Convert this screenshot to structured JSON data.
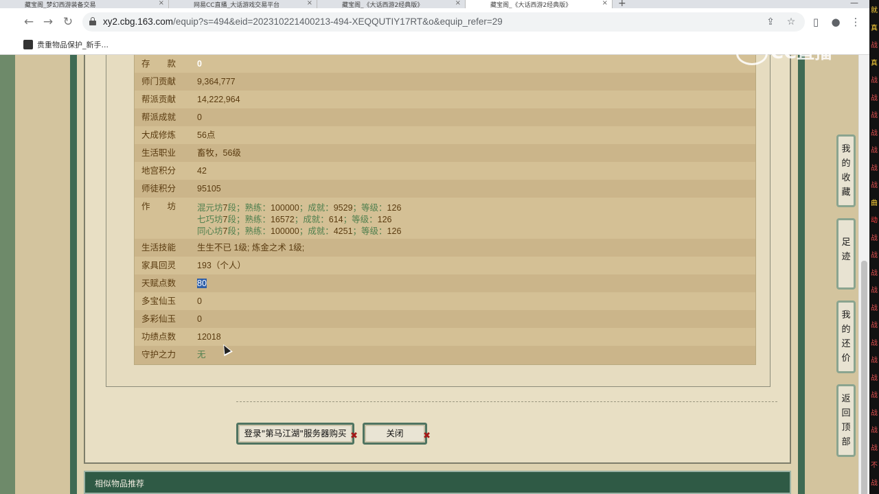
{
  "browser": {
    "tabs": [
      {
        "title": "藏宝阁_梦幻西游装备交易",
        "active": false
      },
      {
        "title": "网易CC直播_大话游戏交易平台",
        "active": false
      },
      {
        "title": "藏宝阁_《大话西游2经典版》",
        "active": false
      },
      {
        "title": "藏宝阁_《大话西游2经典版》",
        "active": true
      }
    ],
    "url_host": "xy2.cbg.163.com",
    "url_path": "/equip?s=494&eid=202310221400213-494-XEQQUTIY17RT&o&equip_refer=29",
    "bookmark": "贵重物品保护_新手..."
  },
  "watermark": "CC直播",
  "stats": [
    {
      "label": "存　　款",
      "value": "0"
    },
    {
      "label": "师门贡献",
      "value": "9,364,777"
    },
    {
      "label": "帮派贡献",
      "value": "14,222,964"
    },
    {
      "label": "帮派成就",
      "value": "0"
    },
    {
      "label": "大成修炼",
      "value": "56点"
    },
    {
      "label": "生活职业",
      "value": "畜牧，56级"
    },
    {
      "label": "地宫积分",
      "value": "42"
    },
    {
      "label": "师徒积分",
      "value": "95105"
    }
  ],
  "workshop": {
    "label": "作　　坊",
    "lines": [
      {
        "name": "混元坊",
        "stage": "7",
        "seg": "段；熟练：",
        "skill": "100000",
        "ach_label": "；成就：",
        "ach": "9529",
        "lvl_label": "；等级：",
        "lvl": "126"
      },
      {
        "name": "七巧坊",
        "stage": "7",
        "seg": "段；熟练：",
        "skill": "16572",
        "ach_label": "；成就：",
        "ach": "614",
        "lvl_label": "；等级：",
        "lvl": "126"
      },
      {
        "name": "同心坊",
        "stage": "7",
        "seg": "段；熟练：",
        "skill": "100000",
        "ach_label": "；成就：",
        "ach": "4251",
        "lvl_label": "；等级：",
        "lvl": "126"
      }
    ]
  },
  "stats2": [
    {
      "label": "生活技能",
      "value": "生生不已 1级; 炼金之术 1级;"
    },
    {
      "label": "家具回灵",
      "value": "193（个人）"
    },
    {
      "label": "天赋点数",
      "value": "80"
    },
    {
      "label": "多宝仙玉",
      "value": "0"
    },
    {
      "label": "多彩仙玉",
      "value": "0"
    },
    {
      "label": "功绩点数",
      "value": "12018"
    },
    {
      "label": "守护之力",
      "value": "无"
    }
  ],
  "buttons": {
    "login_buy": "登录\"第马江湖\"服务器购买",
    "close": "关闭"
  },
  "similar_header": "相似物品推荐",
  "side_buttons": [
    {
      "chars": [
        "我",
        "的",
        "收",
        "藏"
      ]
    },
    {
      "chars": [
        "足",
        "迹"
      ]
    },
    {
      "chars": [
        "我",
        "的",
        "还",
        "价"
      ]
    },
    {
      "chars": [
        "返",
        "回",
        "顶",
        "部"
      ]
    }
  ],
  "right_strip": [
    "就",
    "真",
    "战",
    "真",
    "战",
    "战",
    "战",
    "战",
    "战",
    "战",
    "战",
    "曲",
    "动",
    "战",
    "战",
    "战",
    "战",
    "战",
    "战",
    "战",
    "战",
    "战",
    "战",
    "战",
    "战",
    "战",
    "不",
    "战"
  ],
  "colors": {
    "label_text": "#5a3b10",
    "green_text": "#4f7f4e",
    "frame_green": "#3f6a53",
    "row_a": "#d4c095",
    "row_b": "#cbb58a"
  }
}
